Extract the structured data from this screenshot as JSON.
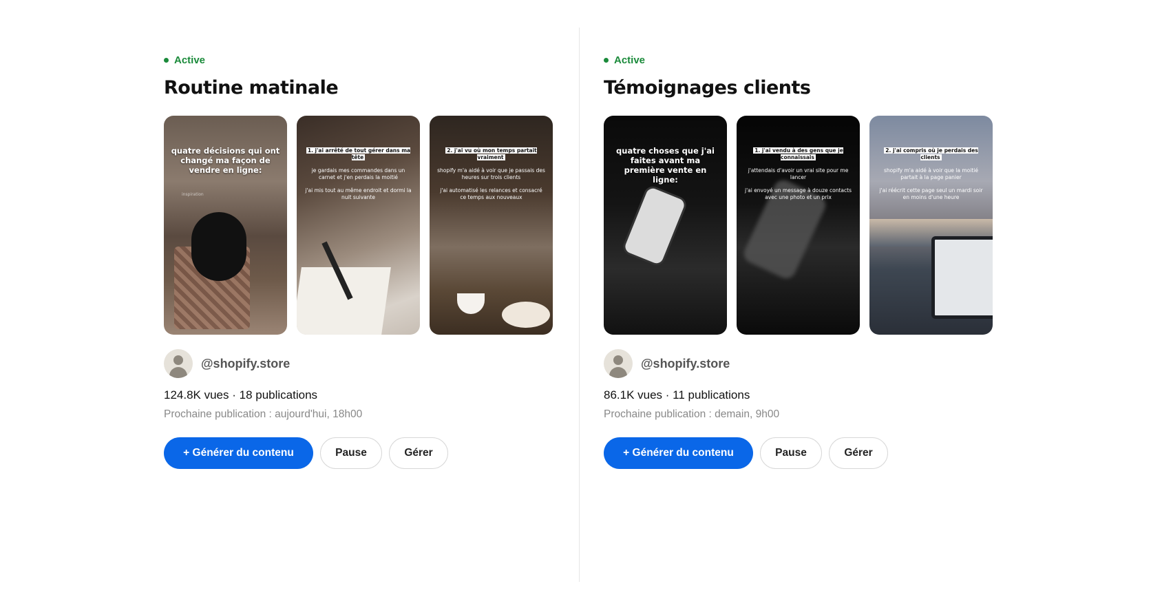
{
  "campaigns": [
    {
      "status": "Active",
      "title": "Routine matinale",
      "thumbnails": [
        {
          "caption": "quatre décisions qui ont changé ma façon de vendre en ligne:",
          "tag": "inspiration"
        },
        {
          "heading": "1. j'ai arrêté de tout gérer dans ma tête",
          "body1": "je gardais mes commandes dans un carnet et j'en perdais la moitié",
          "body2": "j'ai mis tout au même endroit et dormi la nuit suivante"
        },
        {
          "heading": "2. j'ai vu où mon temps partait vraiment",
          "body1": "shopify m'a aidé à voir que je passais des heures sur trois clients",
          "body2": "j'ai automatisé les relances et consacré ce temps aux nouveaux"
        }
      ],
      "handle": "@shopify.store",
      "stats": "124.8K vues · 18 publications",
      "next_publication": "Prochaine publication : aujourd'hui, 18h00",
      "generate_label": "+ Générer du contenu",
      "pause_label": "Pause",
      "manage_label": "Gérer"
    },
    {
      "status": "Active",
      "title": "Témoignages clients",
      "thumbnails": [
        {
          "caption": "quatre choses que j'ai faites avant ma première vente en ligne:"
        },
        {
          "heading": "1. j'ai vendu à des gens que je connaissais",
          "body1": "j'attendais d'avoir un vrai site pour me lancer",
          "body2": "j'ai envoyé un message à douze contacts avec une photo et un prix"
        },
        {
          "heading": "2. j'ai compris où je perdais des clients",
          "body1": "shopify m'a aidé à voir que la moitié partait à la page panier",
          "body2": "j'ai réécrit cette page seul un mardi soir en moins d'une heure"
        }
      ],
      "handle": "@shopify.store",
      "stats": "86.1K vues · 11 publications",
      "next_publication": "Prochaine publication : demain, 9h00",
      "generate_label": "+ Générer du contenu",
      "pause_label": "Pause",
      "manage_label": "Gérer"
    }
  ],
  "colors": {
    "active": "#1a8a3a",
    "primary": "#0a67e8"
  }
}
